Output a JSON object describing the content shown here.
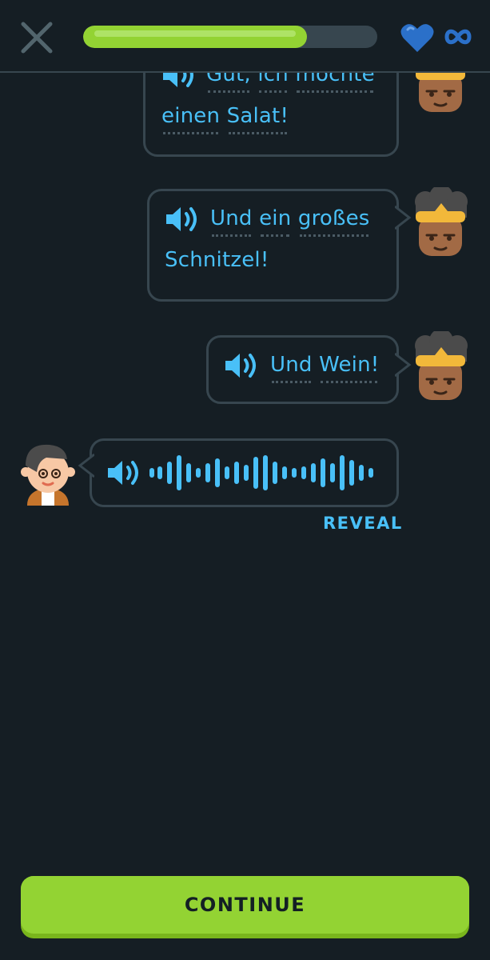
{
  "header": {
    "progress_fraction": 0.76,
    "hearts": "∞"
  },
  "messages": [
    {
      "speaker": "character-bandana",
      "lines": [
        [
          "Gut,",
          "ich",
          "möchte"
        ],
        [
          "einen",
          "Salat!"
        ]
      ]
    },
    {
      "speaker": "character-bandana",
      "lines": [
        [
          "Und",
          "ein",
          "großes"
        ],
        [
          "Schnitzel!"
        ]
      ]
    },
    {
      "speaker": "character-bandana",
      "lines": [
        [
          "Und",
          "Wein!"
        ]
      ]
    },
    {
      "speaker": "character-boy",
      "audio_only": true
    }
  ],
  "reveal_label": "REVEAL",
  "continue_label": "CONTINUE",
  "colors": {
    "background": "#151e24",
    "accent_blue": "#49c0f8",
    "progress_green": "#93d333",
    "heart_blue": "#2b70c9",
    "border": "#37464f"
  },
  "icons": [
    "close-icon",
    "heart-icon",
    "infinity-icon",
    "speaker-icon",
    "audio-waveform-icon"
  ]
}
